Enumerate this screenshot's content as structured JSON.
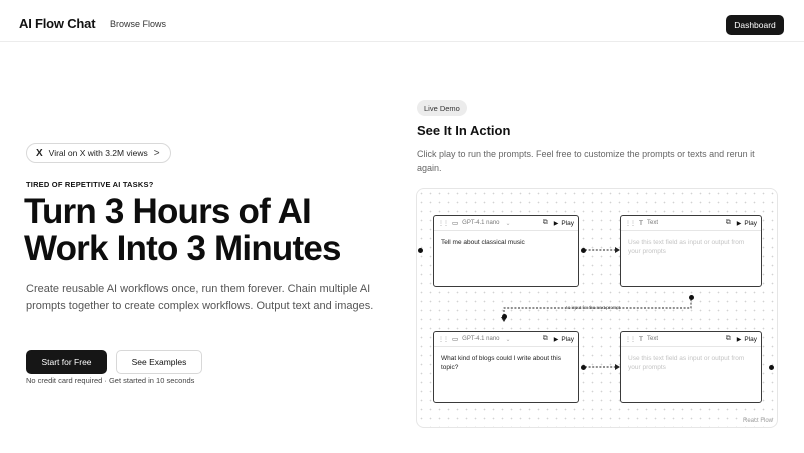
{
  "header": {
    "brand": "AI Flow Chat",
    "nav_link": "Browse Flows",
    "dashboard_button": "Dashboard"
  },
  "hero": {
    "pill_icon": "X",
    "pill_text": "Viral on X with 3.2M views",
    "pill_chevron": ">",
    "eyebrow": "TIRED OF REPETITIVE AI TASKS?",
    "headline_line1": "Turn 3 Hours of AI",
    "headline_line2": "Work Into 3 Minutes",
    "subtext": "Create reusable AI workflows once, run them forever. Chain multiple AI prompts together to create complex workflows. Output text and images.",
    "primary_button": "Start for Free",
    "secondary_button": "See Examples",
    "note": "No credit card required · Get started in 10 seconds"
  },
  "demo": {
    "badge": "Live Demo",
    "title": "See It In Action",
    "description": "Click play to run the prompts. Feel free to customize the prompts or texts and rerun it again.",
    "watermark": "React Flow",
    "edge_label": "As input for the next prompt",
    "nodes": [
      {
        "type_label": "GPT-4.1 nano",
        "play_label": "Play",
        "body": "Tell me about classical music"
      },
      {
        "type_label": "Text",
        "play_label": "Play",
        "body": "Use this text field as input or output from your prompts"
      },
      {
        "type_label": "GPT-4.1 nano",
        "play_label": "Play",
        "body": "What kind of blogs could I write about this topic?"
      },
      {
        "type_label": "Text",
        "play_label": "Play",
        "body": "Use this text field as input or output from your prompts"
      }
    ]
  },
  "icons": {
    "grip": "grip-icon",
    "chat": "chat-icon",
    "text": "text-icon",
    "copy": "copy-icon",
    "play": "play-icon",
    "x_logo": "x-logo-icon",
    "chevron": "chevron-right-icon"
  },
  "colors": {
    "primary_button": "#161616",
    "border": "#e6e6e6",
    "muted_text": "#666666"
  }
}
